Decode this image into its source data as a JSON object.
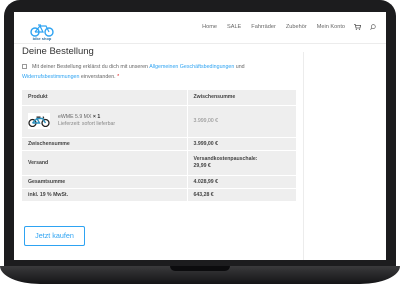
{
  "header": {
    "logo_text": "bike shop",
    "nav": [
      "Home",
      "SALE",
      "Fahrräder",
      "Zubehör",
      "Mein Konto"
    ],
    "cart_icon": "cart-icon",
    "search_icon": "search-icon"
  },
  "page": {
    "title": "Deine Bestellung",
    "terms": {
      "prefix": "Mit deiner Bestellung erklärst du dich mit unseren ",
      "link1": "Allgemeinen Geschäftsbedingungen",
      "middle": " und",
      "link2": "Widerrufsbestimmungen",
      "suffix": " einverstanden.",
      "required_mark": "*"
    }
  },
  "order": {
    "head_product": "Produkt",
    "head_subtotal": "Zwischensumme",
    "item": {
      "name": "eWME 5.9 MX",
      "qty": "× 1",
      "delivery": "Lieferzeit: sofort lieferbar",
      "price": "3.999,00 €"
    },
    "subtotal_label": "Zwischensumme",
    "subtotal_value": "3.999,00 €",
    "shipping_label": "Versand",
    "shipping_name": "Versandkostenpauschale:",
    "shipping_value": "29,99 €",
    "total_label": "Gesamtsumme",
    "total_value": "4.028,99 €",
    "tax_label": "inkl. 19 % MwSt.",
    "tax_value": "643,28 €"
  },
  "buy_button": "Jetzt kaufen",
  "colors": {
    "accent": "#2ea3f2",
    "required": "#e01a1a",
    "table_bg": "#eeeeee"
  }
}
